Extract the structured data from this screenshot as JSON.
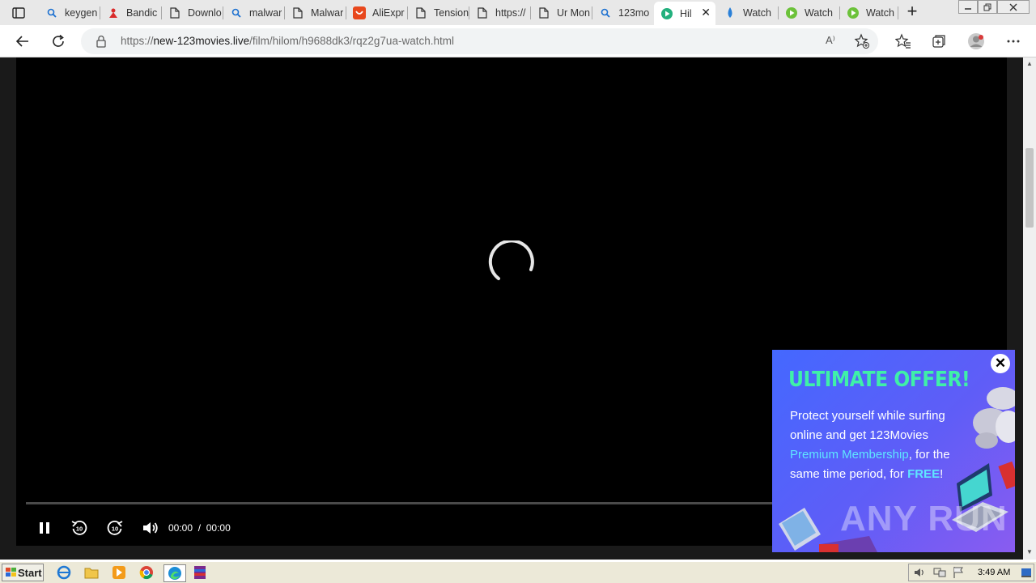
{
  "browser": {
    "tabs": [
      {
        "label": "keygen",
        "icon": "search-icon"
      },
      {
        "label": "Bandic",
        "icon": "bandicam-icon"
      },
      {
        "label": "Downlo",
        "icon": "page-icon"
      },
      {
        "label": "malwar",
        "icon": "search-icon"
      },
      {
        "label": "Malwar",
        "icon": "page-icon"
      },
      {
        "label": "AliExpr",
        "icon": "aliexpress-icon"
      },
      {
        "label": "Tension",
        "icon": "page-icon"
      },
      {
        "label": "https://",
        "icon": "page-icon"
      },
      {
        "label": "Ur Mon",
        "icon": "page-icon"
      },
      {
        "label": "123mo",
        "icon": "search-icon"
      },
      {
        "label": "Hil",
        "icon": "play-icon",
        "active": true
      },
      {
        "label": "Watch",
        "icon": "drop-icon"
      },
      {
        "label": "Watch",
        "icon": "play-icon"
      },
      {
        "label": "Watch",
        "icon": "play-icon"
      }
    ],
    "close_tab_glyph": "✕",
    "new_tab_glyph": "+",
    "address": {
      "scheme": "https://",
      "host": "new-123movies.live",
      "path": "/film/hilom/h9688dk3/rqz2g7ua-watch.html"
    },
    "read_aloud_glyph": "A⁾"
  },
  "player": {
    "current_time": "00:00",
    "separator": "/",
    "duration": "00:00",
    "state": "loading",
    "progress": 0
  },
  "ad": {
    "title": "ULTIMATE OFFER!",
    "text_1": "Protect yourself while surfing online and get 123Movies ",
    "highlight_1": "Premium Membership",
    "text_2": ", for the same time period, for ",
    "highlight_2": "FREE",
    "text_3": "!",
    "close_glyph": "✕",
    "colors": {
      "title": "#3ff0a8",
      "highlight": "#5fe6ff",
      "background": "#5060f8"
    }
  },
  "watermark": "ANY RUN",
  "taskbar": {
    "start_label": "Start",
    "apps": [
      "ie-icon",
      "folder-icon",
      "media-player-icon",
      "chrome-icon",
      "edge-icon",
      "winrar-icon"
    ],
    "clock": "3:49 AM"
  }
}
